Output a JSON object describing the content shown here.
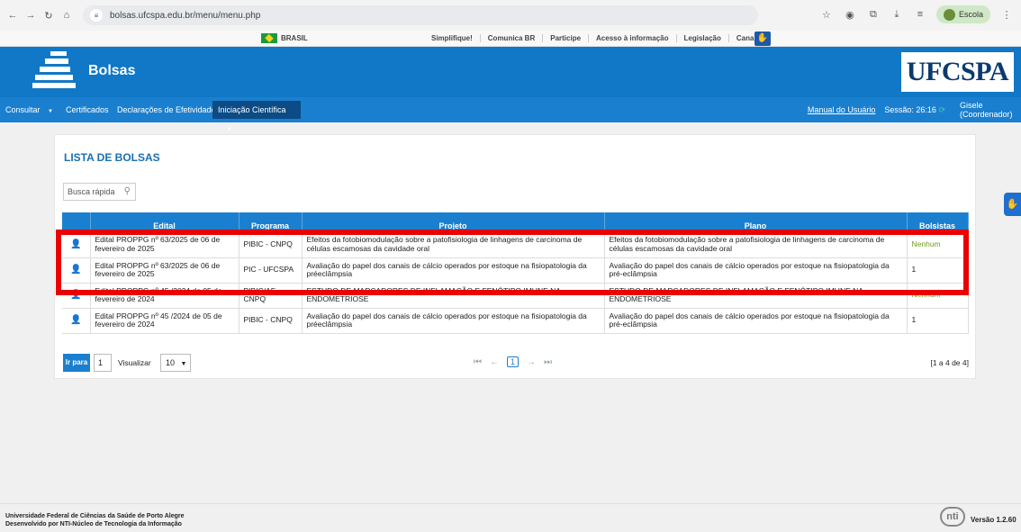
{
  "browser": {
    "url": "bolsas.ufcspa.edu.br/menu/menu.php",
    "profile_label": "Escola"
  },
  "gov_bar": {
    "brasil": "BRASIL",
    "links": [
      "Simplifique!",
      "Comunica BR",
      "Participe",
      "Acesso à informação",
      "Legislação",
      "Canais"
    ]
  },
  "header": {
    "app_title": "Bolsas",
    "institution_logo": "UFCSPA"
  },
  "menu": {
    "items": [
      {
        "label": "Consultar",
        "dropdown": true
      },
      {
        "label": "Certificados",
        "dropdown": false
      },
      {
        "label": "Declarações de Efetividade",
        "dropdown": false
      },
      {
        "label": "Iniciação Científica",
        "dropdown": true,
        "active": true
      }
    ],
    "manual_link": "Manual do Usuário",
    "session_text": "Sessão: 26:16",
    "user_name": "Gisele",
    "user_role": "(Coordenador)"
  },
  "content": {
    "title": "LISTA DE BOLSAS",
    "search_placeholder": "Busca rápida",
    "columns": [
      "",
      "Edital",
      "Programa",
      "Projeto",
      "Plano",
      "Bolsistas"
    ],
    "rows": [
      {
        "edital": "Edital PROPPG nº 63/2025 de 06 de fevereiro de 2025",
        "programa": "PIBIC - CNPQ",
        "projeto": "Efeitos da fotobiomodulação sobre a patofisiologia de linhagens de carcinoma de células escamosas da cavidade oral",
        "plano": "Efeitos da fotobiomodulação sobre a patofisiologia de linhagens de carcinoma de células escamosas da cavidade oral",
        "bolsistas": "Nenhum"
      },
      {
        "edital": "Edital PROPPG nº 63/2025 de 06 de fevereiro de 2025",
        "programa": "PIC - UFCSPA",
        "projeto": "Avaliação do papel dos canais de cálcio operados por estoque na fisiopatologia da préeclâmpsia",
        "plano": "Avaliação do papel dos canais de cálcio operados por estoque na fisiopatologia da pré-eclâmpsia",
        "bolsistas": "1"
      },
      {
        "edital": "Edital PROPPG nº 45 /2024 de 05 de fevereiro de 2024",
        "programa": "PIBIC/AF - CNPQ",
        "projeto": "ESTUDO DE MARCADORES DE INFLAMAÇÃO E FENÓTIPO IMUNE NA ENDOMETRIOSE",
        "plano": "ESTUDO DE MARCADORES DE INFLAMAÇÃO E FENÓTIPO IMUNE NA ENDOMETRIOSE",
        "bolsistas": "Nenhum"
      },
      {
        "edital": "Edital PROPPG nº 45 /2024 de 05 de fevereiro de 2024",
        "programa": "PIBIC - CNPQ",
        "projeto": "Avaliação do papel dos canais de cálcio operados por estoque na fisiopatologia da préeclâmpsia",
        "plano": "Avaliação do papel dos canais de cálcio operados por estoque na fisiopatologia da pré-eclâmpsia",
        "bolsistas": "1"
      }
    ],
    "pager": {
      "go_label": "Ir para",
      "page_value": "1",
      "view_label": "Visualizar",
      "page_size": "10",
      "current_page": "1",
      "info": "[1 a 4 de 4]"
    }
  },
  "footer": {
    "line1": "Universidade Federal de Ciências da Saúde de Porto Alegre",
    "line2": "Desenvolvido por NTI-Núcleo de Tecnologia da Informação",
    "nti_logo": "nti",
    "version": "Versão 1.2.60"
  },
  "colors": {
    "header_blue": "#1078c6",
    "menu_blue": "#1b7fcf",
    "active_menu": "#0b4b86",
    "highlight_red": "#ea0000",
    "nenhum_green": "#6f9d1a"
  }
}
